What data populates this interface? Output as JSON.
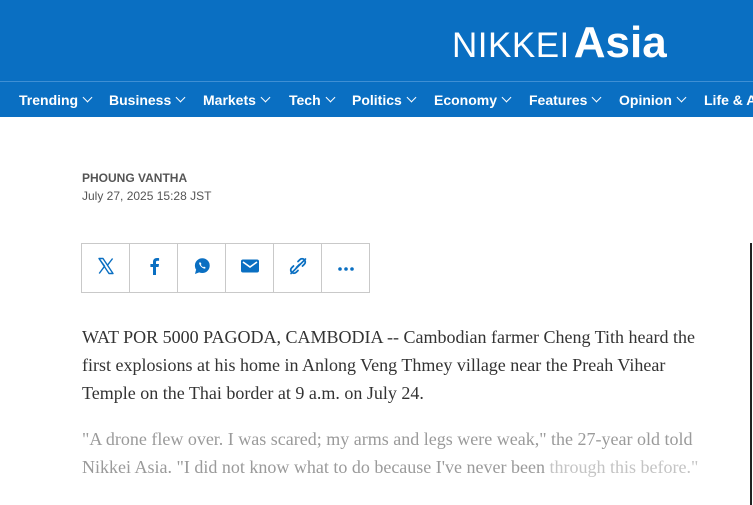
{
  "brand": {
    "nikkei": "NIKKEI",
    "asia": "Asia"
  },
  "nav": {
    "items": [
      {
        "label": "Trending"
      },
      {
        "label": "Business"
      },
      {
        "label": "Markets"
      },
      {
        "label": "Tech"
      },
      {
        "label": "Politics"
      },
      {
        "label": "Economy"
      },
      {
        "label": "Features"
      },
      {
        "label": "Opinion"
      },
      {
        "label": "Life & A"
      }
    ]
  },
  "article": {
    "author": "PHOUNG VANTHA",
    "date": "July 27, 2025 15:28 JST",
    "paragraph1": "WAT POR 5000 PAGODA, CAMBODIA -- Cambodian farmer Cheng Tith heard the first explosions at his home in Anlong Veng Thmey village near the Preah Vihear Temple on the Thai border at 9 a.m. on July 24.",
    "paragraph2": "\"A drone flew over. I was scared; my arms and legs were weak,\" the 27-year old told Nikkei Asia. \"I did not know what to do because I've never been",
    "paragraph2_faded": "through this before.\""
  },
  "share": {
    "icons": [
      "x-icon",
      "facebook-icon",
      "whatsapp-icon",
      "email-icon",
      "link-icon",
      "more-icon"
    ]
  },
  "colors": {
    "brand_blue": "#0a6fc2",
    "share_icon": "#0a6fc2"
  }
}
